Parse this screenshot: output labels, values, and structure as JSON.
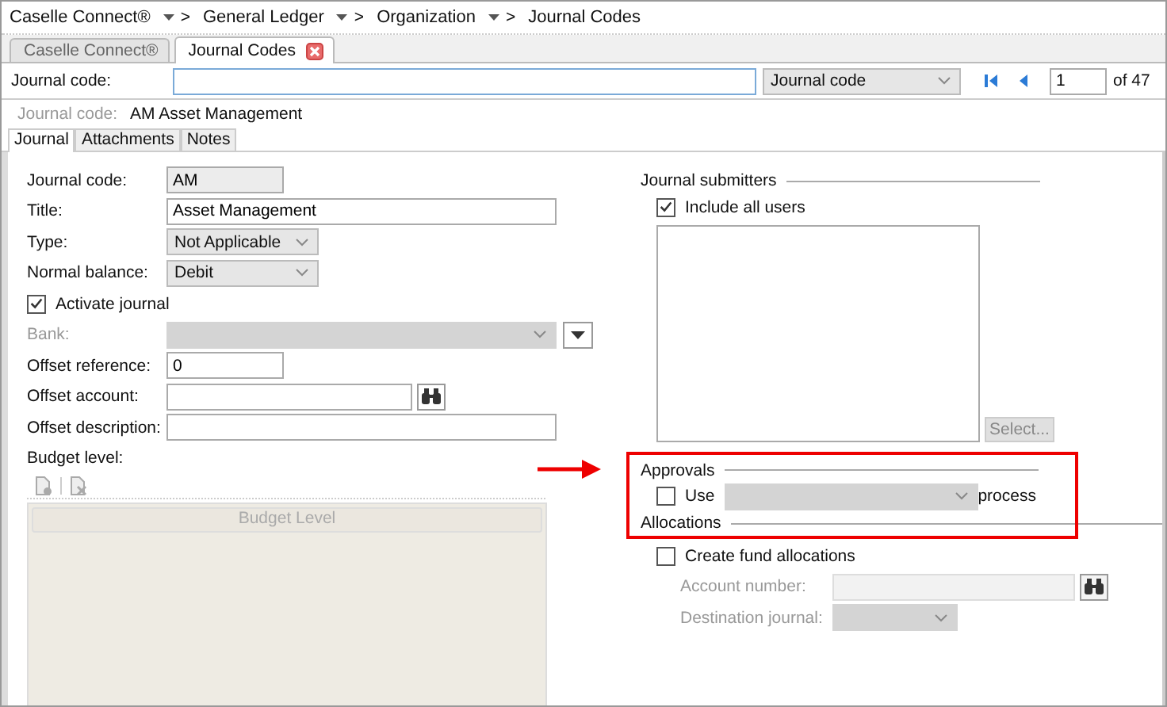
{
  "breadcrumb": [
    {
      "label": "Caselle Connect®",
      "has_menu": true,
      "separator": ">"
    },
    {
      "label": "General Ledger",
      "has_menu": true,
      "separator": ">"
    },
    {
      "label": "Organization",
      "has_menu": true,
      "separator": ">"
    },
    {
      "label": "Journal Codes",
      "has_menu": false
    }
  ],
  "tabs": [
    {
      "label": "Caselle Connect®",
      "selected": false,
      "closable": false
    },
    {
      "label": "Journal Codes",
      "selected": true,
      "closable": true
    }
  ],
  "search": {
    "label": "Journal code:",
    "search_by": "Journal code",
    "page": "1",
    "page_count": "of 47"
  },
  "record": {
    "label": "Journal code:",
    "value": "AM Asset Management"
  },
  "subtabs": [
    {
      "label": "Journal",
      "selected": true
    },
    {
      "label": "Attachments",
      "selected": false
    },
    {
      "label": "Notes",
      "selected": false
    }
  ],
  "journal_code": {
    "label": "Journal code:",
    "value": "AM"
  },
  "title": {
    "label": "Title:",
    "value": "Asset Management"
  },
  "type": {
    "label": "Type:",
    "value": "Not Applicable"
  },
  "normal_balance": {
    "label": "Normal balance:",
    "value": "Debit"
  },
  "activate_journal": {
    "label": "Activate journal",
    "checked": true
  },
  "bank": {
    "label": "Bank:",
    "disabled": true
  },
  "offset_reference": {
    "label": "Offset reference:",
    "value": "0"
  },
  "offset_account": {
    "label": "Offset account:"
  },
  "offset_description": {
    "label": "Offset description:"
  },
  "budget_level": {
    "label": "Budget level:",
    "column": "Budget Level",
    "disabled": true
  },
  "journal_submitters": {
    "heading": "Journal submitters",
    "include_all_users": {
      "label": "Include all users",
      "checked": true
    },
    "select_button": {
      "label": "Select...",
      "disabled": true
    }
  },
  "approvals": {
    "heading": "Approvals",
    "use": {
      "label": "Use",
      "checked": false
    },
    "process_label": "process"
  },
  "allocations": {
    "heading": "Allocations",
    "create": {
      "label": "Create fund allocations",
      "checked": false
    },
    "account_number": {
      "label": "Account number:",
      "disabled": true
    },
    "destination_journal": {
      "label": "Destination journal:",
      "disabled": true
    }
  }
}
